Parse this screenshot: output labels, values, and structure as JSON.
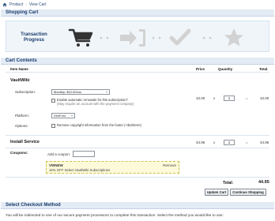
{
  "breadcrumb": {
    "home_icon": "home-icon",
    "items": [
      "Product",
      "View Cart"
    ]
  },
  "sections": {
    "shopping_cart": "Shopping Cart",
    "cart_contents": "Cart Contents",
    "checkout": "Select Checkout Method"
  },
  "progress": {
    "label_line1": "Transaction",
    "label_line2": "Progress",
    "steps": [
      "cart-icon",
      "enter-icon",
      "checkmark-icon",
      "star-icon"
    ],
    "active_color": "#333333",
    "inactive_color": "#d2d2d2"
  },
  "columns": {
    "item": "Item Name",
    "price": "Price",
    "quantity": "Quantity",
    "total": "Total"
  },
  "items": [
    {
      "name": "VaultWiki",
      "subscription_label": "Subscription:",
      "subscription_value": "Monthly: $10.00/mo",
      "renew_text": "Enable automatic renewals for this subscription?",
      "renew_note": "(May require an account with the payment company)",
      "platform_label": "Platform:",
      "platform_value": "XenForo",
      "options_label": "Options:",
      "options_text": "Remove copyright information from the footer (+$10/term)",
      "price": "10.00",
      "x": "x",
      "quantity": "1",
      "eq": "=",
      "total": "10.00"
    },
    {
      "name": "Install Service",
      "price": "34.95",
      "x": "x",
      "quantity": "1",
      "eq": "=",
      "total": "34.95"
    }
  ],
  "coupons": {
    "label": "Coupons:",
    "add_label": "Add a coupon:",
    "input_value": "",
    "applied_code": "VWNEW",
    "applied_desc": "15% OFF Select VaultWiki Subscriptions",
    "remove_label": "Remove",
    "box_color": "#fdfad9"
  },
  "total": {
    "label": "Total:",
    "value": "44.95"
  },
  "buttons": {
    "update": "Update Cart",
    "continue": "Continue Shopping"
  },
  "checkout_text": "You will be redirected to one of our secure payment processors to complete this transaction. Select the method you would like to use:"
}
